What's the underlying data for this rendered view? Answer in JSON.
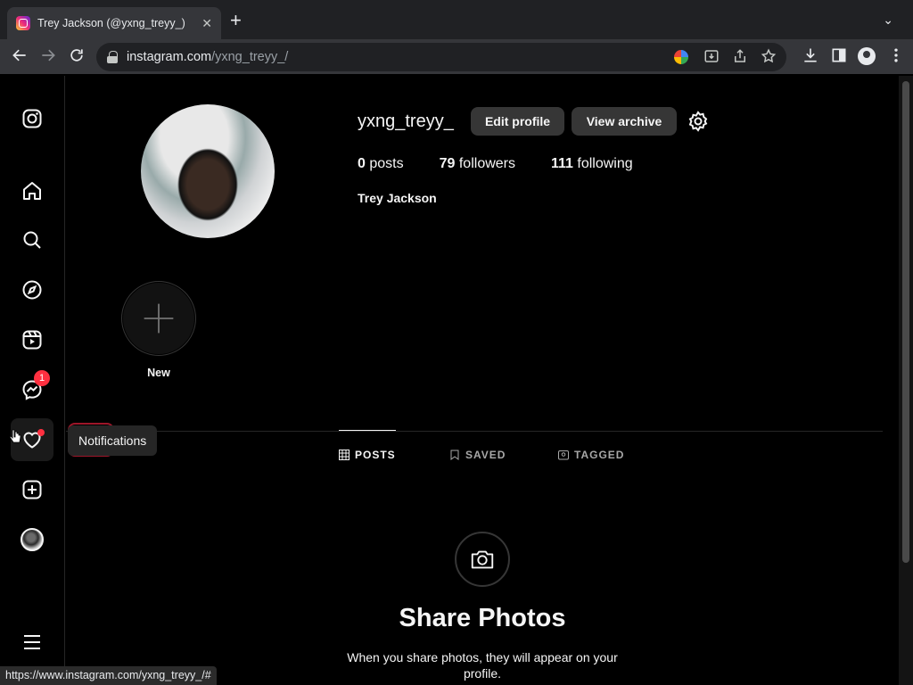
{
  "browser": {
    "tab_title": "Trey Jackson (@yxng_treyy_)",
    "tab_close": "✕",
    "new_tab": "+",
    "tab_menu": "⌄",
    "url_host": "instagram.com",
    "url_path": "/yxng_treyy_/",
    "status_url": "https://www.instagram.com/yxng_treyy_/#"
  },
  "sidebar": {
    "items": [
      {
        "name": "instagram-logo-icon"
      },
      {
        "name": "home-icon"
      },
      {
        "name": "search-icon"
      },
      {
        "name": "explore-icon"
      },
      {
        "name": "reels-icon"
      },
      {
        "name": "messenger-icon",
        "badge": "1"
      },
      {
        "name": "heart-icon"
      },
      {
        "name": "create-icon"
      },
      {
        "name": "profile-avatar"
      },
      {
        "name": "menu-icon"
      }
    ],
    "tooltip": "Notifications"
  },
  "profile": {
    "username": "yxng_treyy_",
    "edit_label": "Edit profile",
    "archive_label": "View archive",
    "posts_count": "0",
    "posts_label": "posts",
    "followers_count": "79",
    "followers_label": "followers",
    "following_count": "111",
    "following_label": "following",
    "full_name": "Trey Jackson",
    "new_story_label": "New"
  },
  "tabs": [
    {
      "label": "POSTS",
      "active": true
    },
    {
      "label": "SAVED",
      "active": false
    },
    {
      "label": "TAGGED",
      "active": false
    }
  ],
  "empty_state": {
    "title": "Share Photos",
    "description": "When you share photos, they will appear on your profile."
  },
  "colors": {
    "background": "#000000",
    "badge": "#ff3040",
    "button": "#363636"
  }
}
